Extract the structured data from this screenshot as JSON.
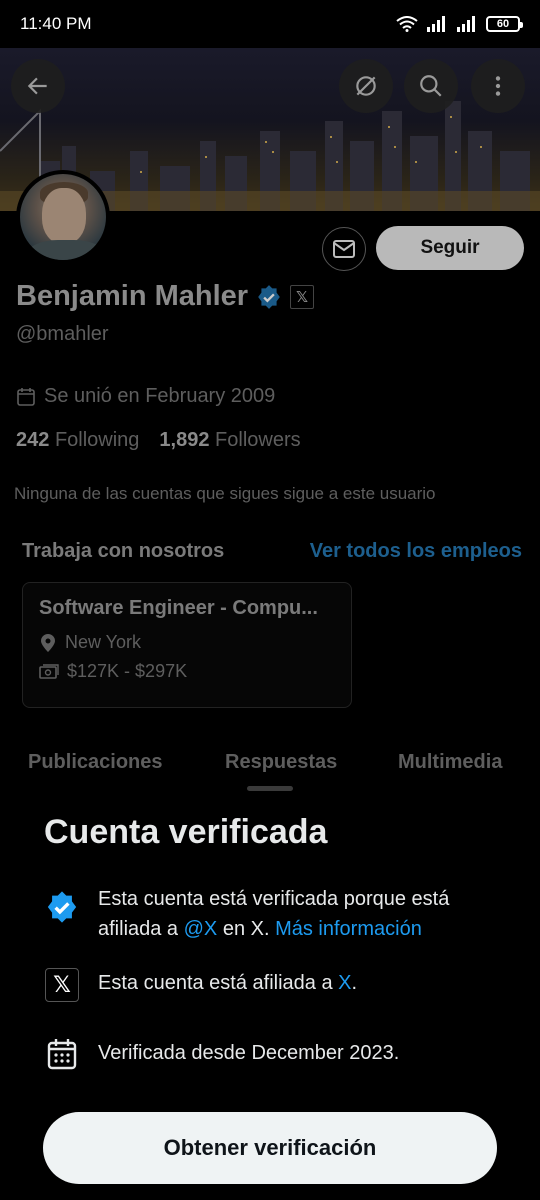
{
  "status_bar": {
    "time": "11:40 PM",
    "battery": "60"
  },
  "profile": {
    "name": "Benjamin Mahler",
    "handle": "@bmahler",
    "follow_label": "Seguir",
    "joined": "Se unió en February 2009",
    "following_count": "242",
    "following_label": "Following",
    "followers_count": "1,892",
    "followers_label": "Followers",
    "not_followed_note": "Ninguna de las cuentas que sigues sigue a este usuario",
    "jobs_title": "Trabaja con nosotros",
    "jobs_link": "Ver todos los empleos",
    "job": {
      "title": "Software Engineer - Compu...",
      "location": "New York",
      "salary": "$127K - $297K"
    },
    "tabs": [
      "Publicaciones",
      "Respuestas",
      "Multimedia"
    ]
  },
  "sheet": {
    "title": "Cuenta verificada",
    "row1_text_a": "Esta cuenta está verificada porque está afiliada a ",
    "row1_link_a": "@X",
    "row1_text_b": " en X. ",
    "row1_link_b": "Más información",
    "row2_text": "Esta cuenta está afiliada a ",
    "row2_link": "X",
    "row2_end": ".",
    "row3_text": "Verificada desde December 2023.",
    "cta_label": "Obtener verificación"
  },
  "colors": {
    "accent": "#1d9bf0",
    "background": "#000000",
    "text": "#e7e9ea",
    "cta_bg": "#eff3f4"
  }
}
